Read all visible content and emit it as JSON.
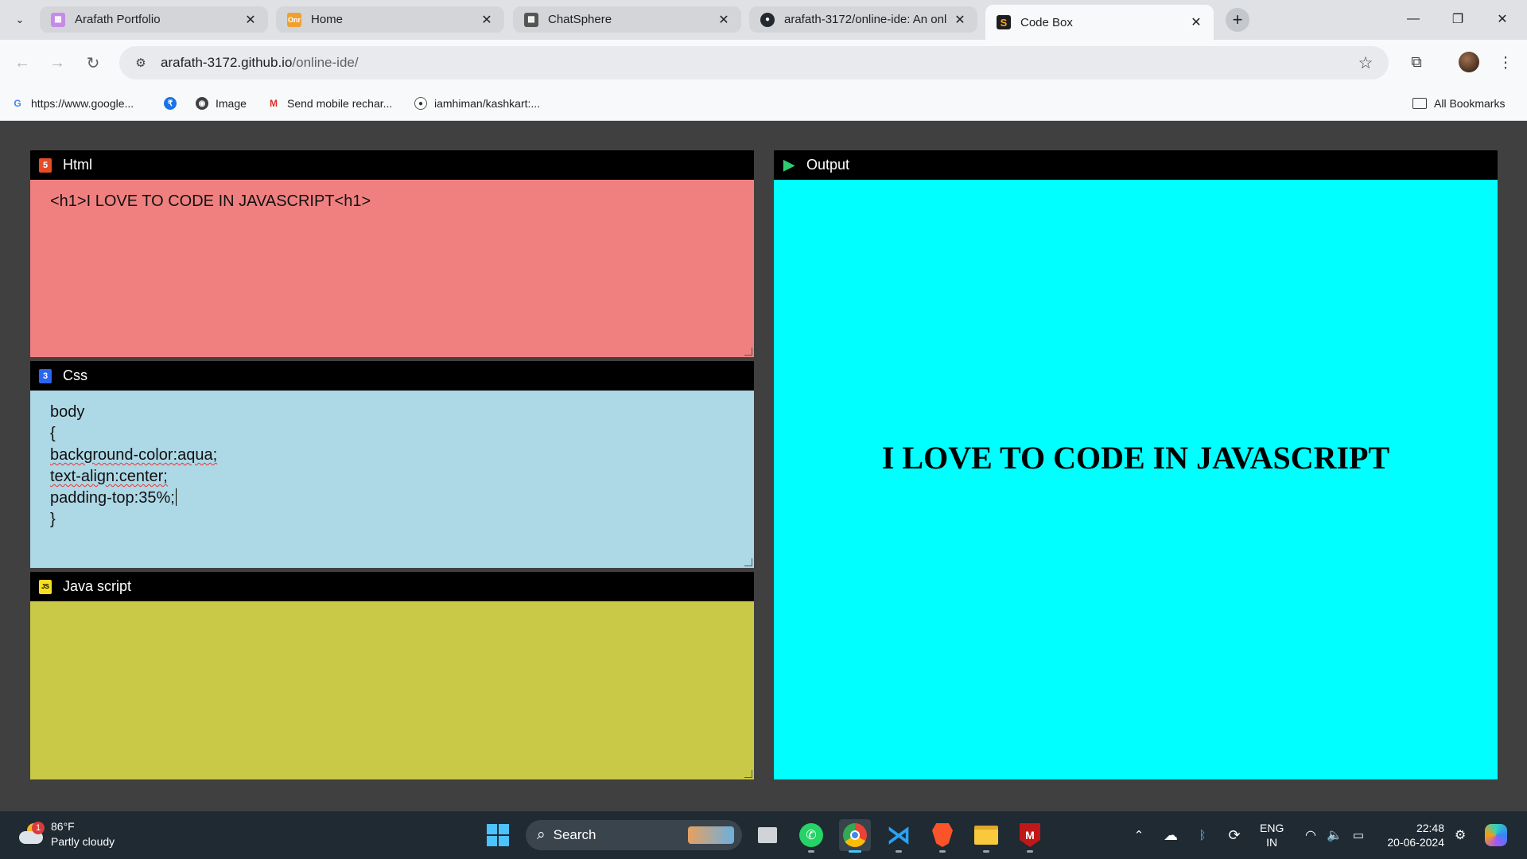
{
  "browser": {
    "tabs": [
      {
        "title": "Arafath Portfolio",
        "icon": "portfolio-favicon",
        "color": "#c58be6"
      },
      {
        "title": "Home",
        "icon": "onr-favicon",
        "color": "#f0a030"
      },
      {
        "title": "ChatSphere",
        "icon": "chatsphere-favicon",
        "color": "#555555"
      },
      {
        "title": "arafath-3172/online-ide: An onl",
        "icon": "github-favicon",
        "color": "#24292f"
      },
      {
        "title": "Code Box",
        "icon": "codebox-favicon",
        "color": "#f5a623"
      }
    ],
    "active_tab": 4,
    "url_host": "arafath-3172.github.io",
    "url_path": "/online-ide/",
    "bookmarks": [
      {
        "label": "https://www.google...",
        "icon": "google-icon"
      },
      {
        "label": "",
        "icon": "blue-bookmark-icon"
      },
      {
        "label": "Image",
        "icon": "image-icon"
      },
      {
        "label": "Send mobile rechar...",
        "icon": "recharge-icon"
      },
      {
        "label": "iamhiman/kashkart:...",
        "icon": "github-icon"
      }
    ],
    "all_bookmarks": "All Bookmarks"
  },
  "ide": {
    "html_panel": {
      "title": "Html",
      "code": "<h1>I LOVE TO CODE IN JAVASCRIPT<h1>",
      "bg": "#f08080"
    },
    "css_panel": {
      "title": "Css",
      "lines": [
        "body",
        "{",
        "background-color:aqua;",
        "text-align:center;",
        "padding-top:35%;",
        "}"
      ],
      "bg": "#add8e6"
    },
    "js_panel": {
      "title": "Java script",
      "code": "",
      "bg": "#c9c947"
    },
    "output_panel": {
      "title": "Output",
      "heading": "I LOVE TO CODE IN JAVASCRIPT",
      "bg": "#00ffff"
    }
  },
  "taskbar": {
    "weather_temp": "86°F",
    "weather_desc": "Partly cloudy",
    "weather_badge": "1",
    "search_label": "Search",
    "lang_top": "ENG",
    "lang_bottom": "IN",
    "time": "22:48",
    "date": "20-06-2024"
  }
}
